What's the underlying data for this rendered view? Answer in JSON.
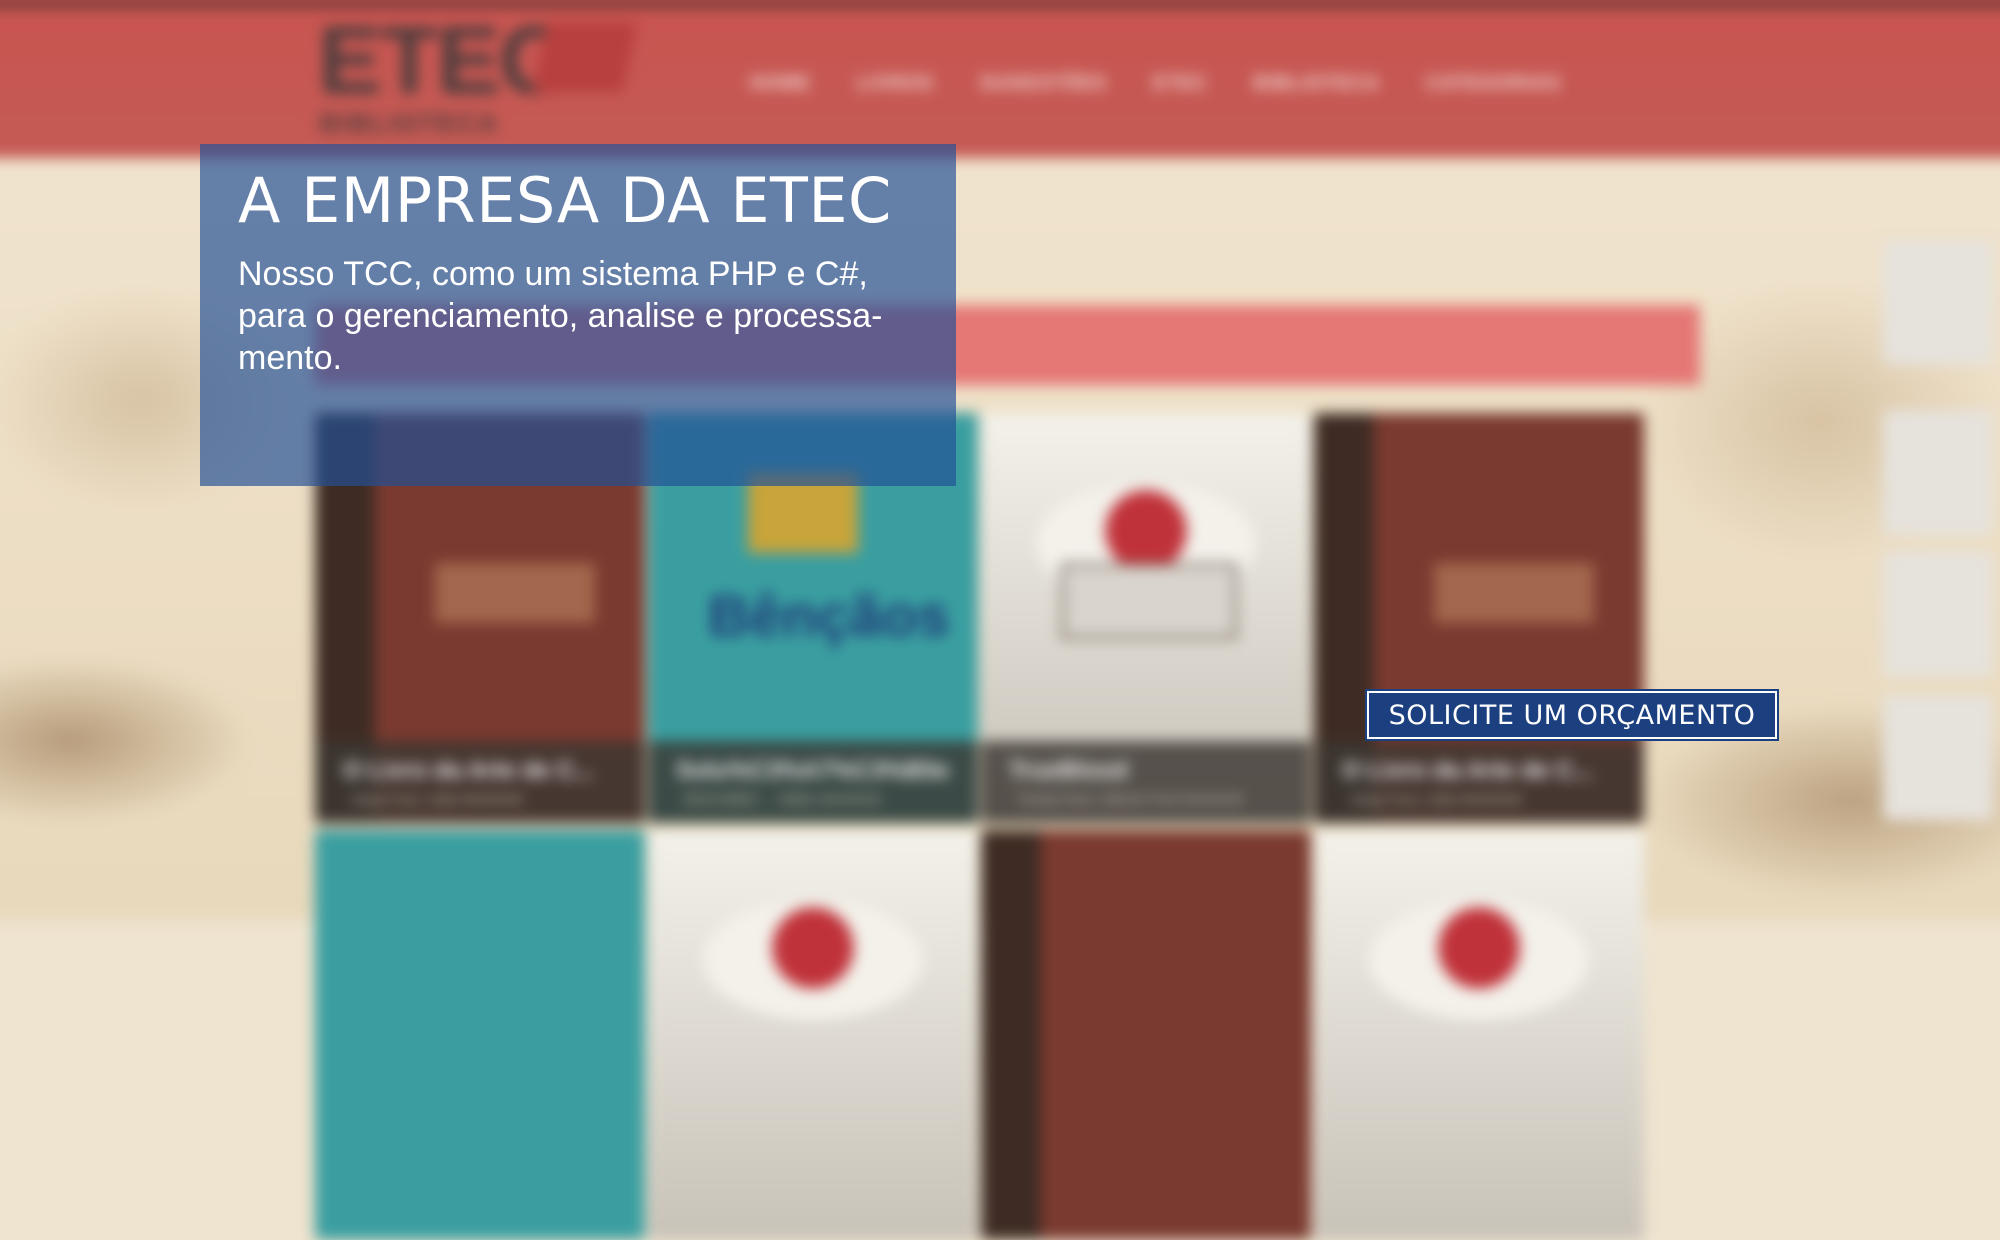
{
  "background_site": {
    "logo_text": "ETEC",
    "logo_subtitle": "BIBLIOTECA",
    "nav": [
      "HOME",
      "LIVROS",
      "SUGESTÕES",
      "ETEC",
      "BIBLIOTECA",
      "CATEGORIAS"
    ],
    "cards": [
      {
        "title": "O Livro da Arte de C...",
        "meta": "Jorge Cruz, Lidia ★★★★★"
      },
      {
        "title": "Solu%C3%A7%C3%B5es de Pallad...",
        "meta": "MOCAMBO ... Vifidio ★★★★★"
      },
      {
        "title": "TrueBlood",
        "meta": "Teorija Kaos, Alberto Fruit ★★★★★"
      },
      {
        "title": "O Livro da Arte de C...",
        "meta": "Jorge Cruz, Lidia ★★★★★"
      }
    ],
    "teal_cover_text": "Bênçãos"
  },
  "hero": {
    "title": "A EMPRESA DA ETEC",
    "description": "Nosso TCC, como um sistema PHP e C#, para o gerenciamento, analise e processa-mento."
  },
  "cta": {
    "label": "SOLICITE UM ORÇAMENTO"
  },
  "colors": {
    "header_red": "#c9534f",
    "overlay_blue": "#224f96",
    "button_blue": "#1c3f7f"
  }
}
